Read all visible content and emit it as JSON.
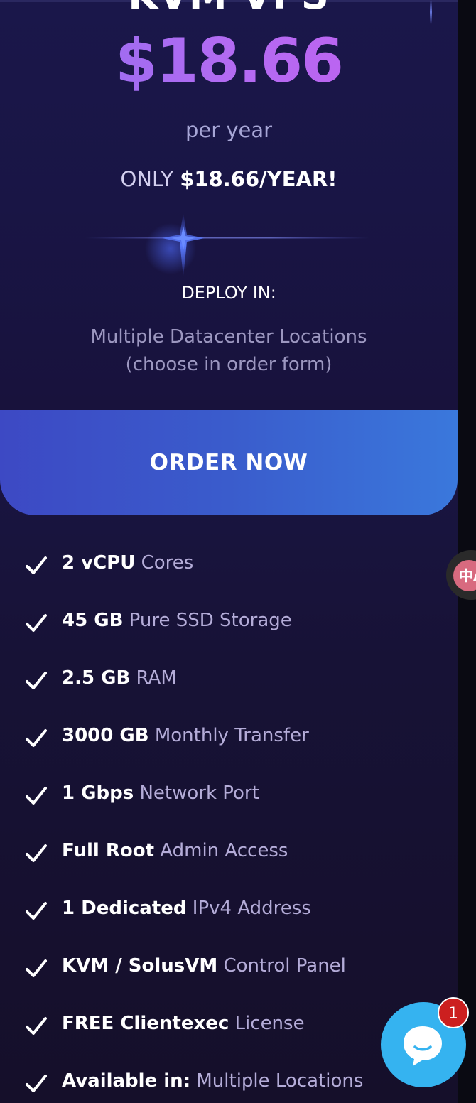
{
  "plan": {
    "name": "KVM VPS",
    "price": "$18.66",
    "period": "per year",
    "only_prefix": "ONLY ",
    "only_price": "$18.66/YEAR!",
    "deploy_title": "DEPLOY IN:",
    "deploy_line1": "Multiple Datacenter Locations",
    "deploy_line2": "(choose in order form)",
    "order_label": "ORDER NOW"
  },
  "features": [
    {
      "strong": "2 vCPU",
      "light": " Cores"
    },
    {
      "strong": "45 GB",
      "light": " Pure SSD Storage"
    },
    {
      "strong": "2.5 GB",
      "light": " RAM"
    },
    {
      "strong": "3000 GB",
      "light": " Monthly Transfer"
    },
    {
      "strong": "1 Gbps",
      "light": " Network Port"
    },
    {
      "strong": "Full Root",
      "light": " Admin Access"
    },
    {
      "strong": "1 Dedicated",
      "light": " IPv4 Address"
    },
    {
      "strong": "KVM / SolusVM",
      "light": " Control Panel"
    },
    {
      "strong": "FREE Clientexec",
      "light": " License"
    },
    {
      "strong": "Available in:",
      "light": " Multiple Locations"
    }
  ],
  "translate_badge": {
    "label": "中A",
    "icon": "translate-icon"
  },
  "chat": {
    "unread_count": "1",
    "icon": "chat-bubble-icon",
    "color": "#35b3f0",
    "badge_color": "#cc1f1f"
  },
  "colors": {
    "accent_gradient_start": "#8e6cf0",
    "accent_gradient_end": "#c35ef0",
    "button_start": "#3d49c4",
    "button_end": "#3a78dc",
    "background": "#150f28"
  }
}
